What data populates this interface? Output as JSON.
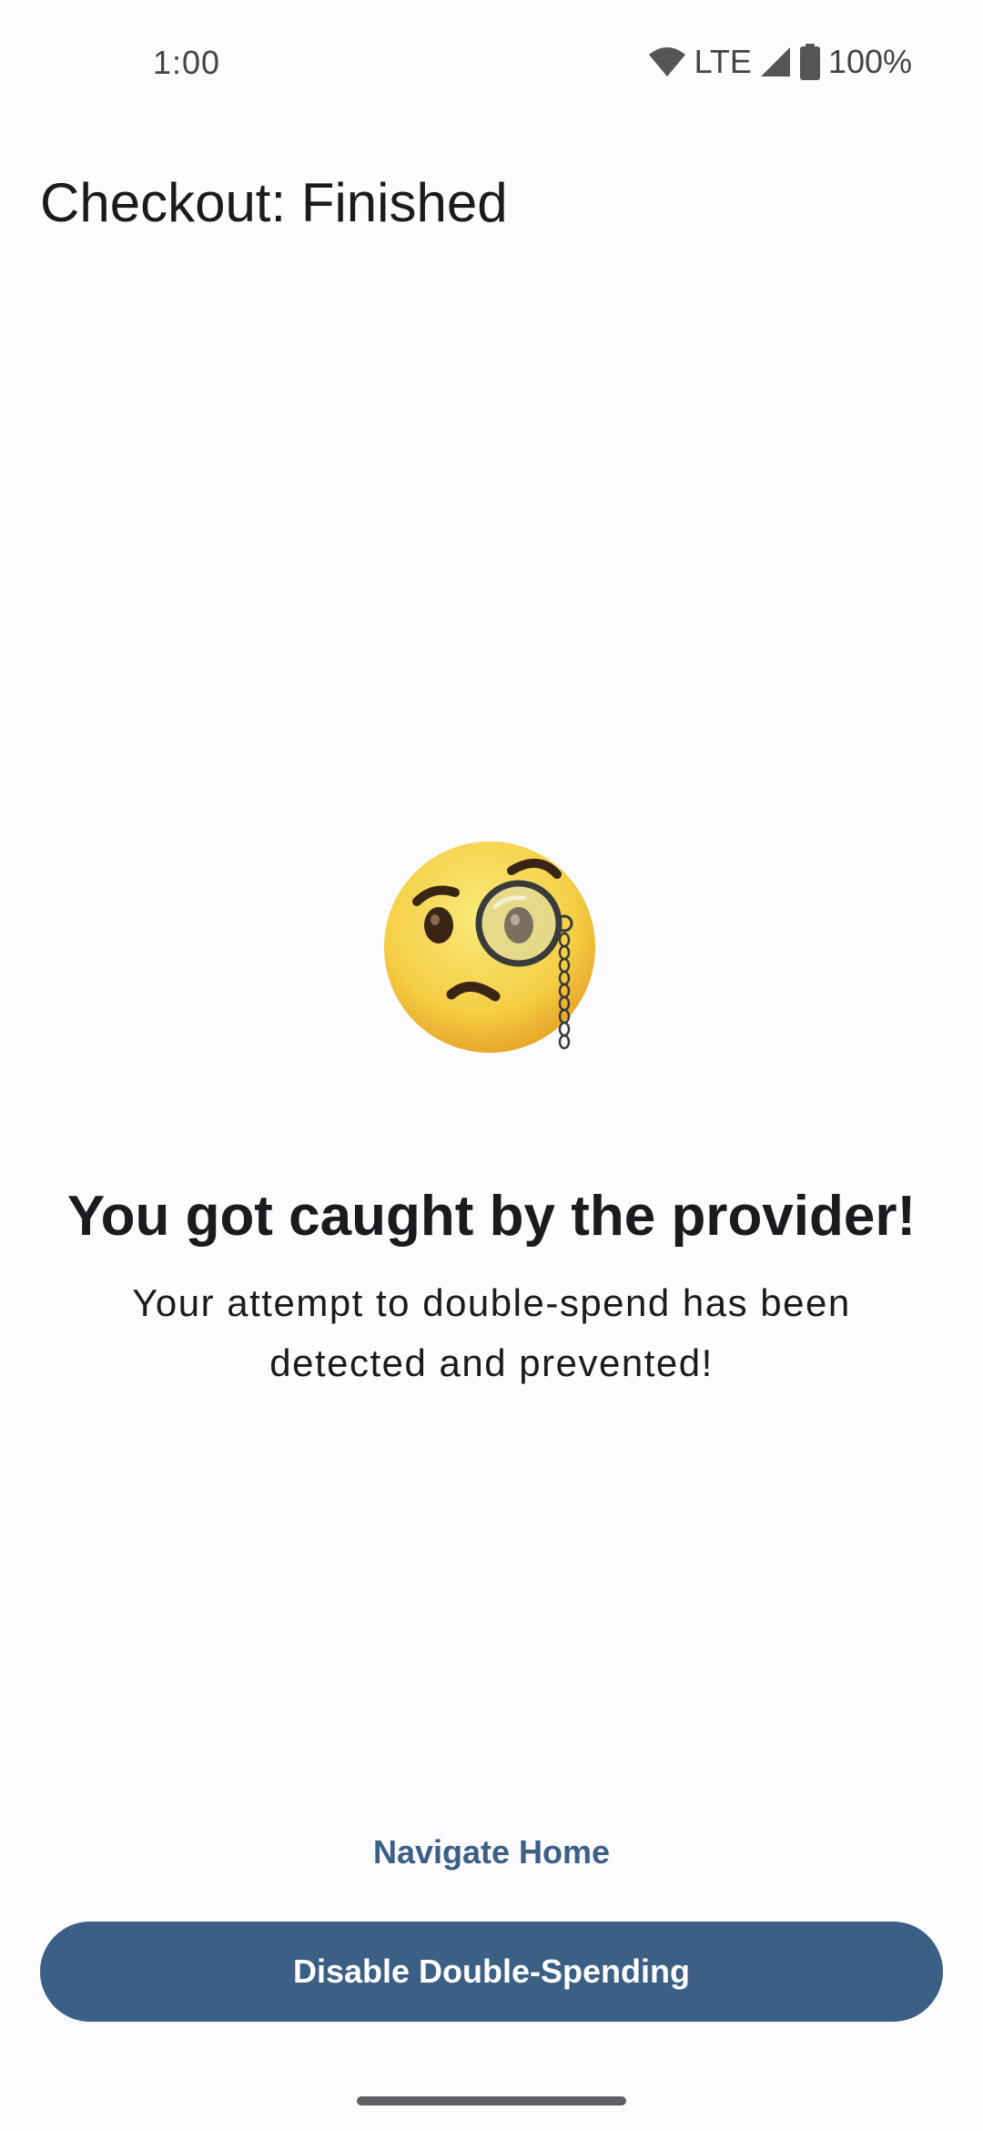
{
  "status_bar": {
    "time": "1:00",
    "network": "LTE",
    "battery": "100%",
    "icons": [
      "wifi-icon",
      "cell-signal-icon",
      "battery-icon"
    ]
  },
  "app_bar": {
    "title": "Checkout: Finished"
  },
  "result": {
    "emoji": "face-with-monocle",
    "headline": "You got caught by the provider!",
    "message": "Your attempt to double-spend has been detected and prevented!"
  },
  "actions": {
    "navigate_home_label": "Navigate Home",
    "disable_double_spending_label": "Disable Double-Spending"
  },
  "colors": {
    "primary": "#3c5f86",
    "background": "#fcfbfe",
    "text": "#1b1b1f"
  }
}
